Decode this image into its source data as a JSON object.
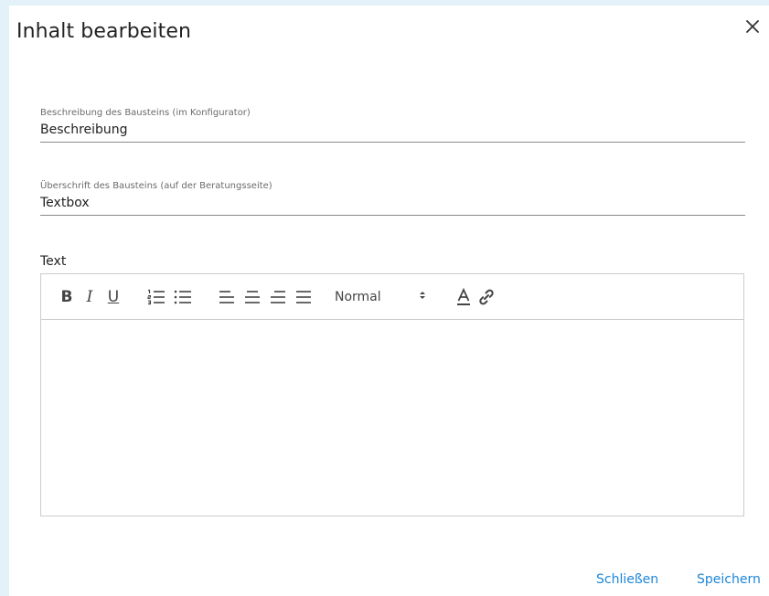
{
  "dialog": {
    "title": "Inhalt bearbeiten"
  },
  "fields": {
    "description": {
      "label": "Beschreibung des Bausteins (im Konfigurator)",
      "value": "Beschreibung"
    },
    "heading": {
      "label": "Überschrift des Bausteins (auf der Beratungsseite)",
      "value": "Textbox"
    }
  },
  "editor": {
    "label": "Text",
    "toolbar": {
      "bold": "B",
      "italic": "I",
      "underline": "U",
      "size_selected": "Normal"
    },
    "content": ""
  },
  "footer": {
    "close_label": "Schließen",
    "save_label": "Speichern"
  },
  "colors": {
    "accent": "#1e86d8",
    "backdrop": "#e3f1f8"
  }
}
